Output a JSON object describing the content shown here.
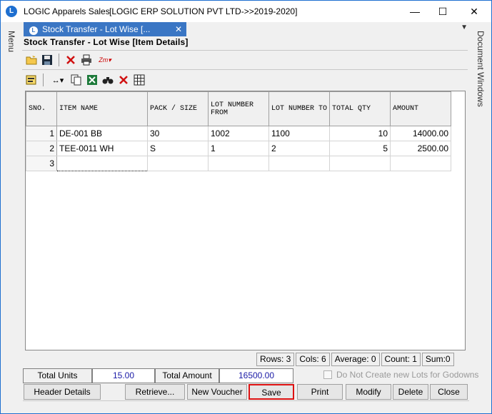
{
  "window": {
    "title": "LOGIC Apparels Sales",
    "subtitle": "[LOGIC ERP SOLUTION PVT LTD->>2019-2020]",
    "minimize": "—",
    "maximize": "☐",
    "close": "✕"
  },
  "left_rail": {
    "label": "Menu"
  },
  "right_rail": {
    "label": "Document Windows"
  },
  "tab": {
    "label": "Stock Transfer - Lot Wise [...",
    "close": "✕",
    "dropdown": "▼"
  },
  "form": {
    "title": "Stock Transfer - Lot Wise [Item Details]"
  },
  "grid": {
    "columns": [
      "SNO.",
      "ITEM NAME",
      "PACK / SIZE",
      "LOT NUMBER FROM",
      "LOT NUMBER TO",
      "TOTAL QTY",
      "AMOUNT"
    ],
    "rows": [
      {
        "sno": "1",
        "item": "DE-001 BB",
        "pack": "30",
        "lot_from": "1002",
        "lot_to": "1100",
        "qty": "10",
        "amount": "14000.00"
      },
      {
        "sno": "2",
        "item": "TEE-0011 WH",
        "pack": "S",
        "lot_from": "1",
        "lot_to": "2",
        "qty": "5",
        "amount": "2500.00"
      },
      {
        "sno": "3",
        "item": "",
        "pack": "",
        "lot_from": "",
        "lot_to": "",
        "qty": "",
        "amount": ""
      }
    ]
  },
  "status": {
    "rows": "Rows: 3",
    "cols": "Cols: 6",
    "average": "Average: 0",
    "count": "Count: 1",
    "sum": "Sum:0"
  },
  "totals": {
    "units_label": "Total Units",
    "units_value": "15.00",
    "amount_label": "Total Amount",
    "amount_value": "16500.00"
  },
  "option": {
    "no_new_lots_label": "Do Not Create new Lots for Godowns"
  },
  "buttons": {
    "header_details": "Header Details",
    "retrieve": "Retrieve...",
    "new_voucher": "New Voucher",
    "save": "Save",
    "print": "Print",
    "modify": "Modify",
    "delete": "Delete",
    "close": "Close"
  },
  "colors": {
    "accent": "#1e6fd0",
    "tab": "#3a76c4",
    "save_border": "#dd1111",
    "totals_text": "#1a1aa6"
  }
}
